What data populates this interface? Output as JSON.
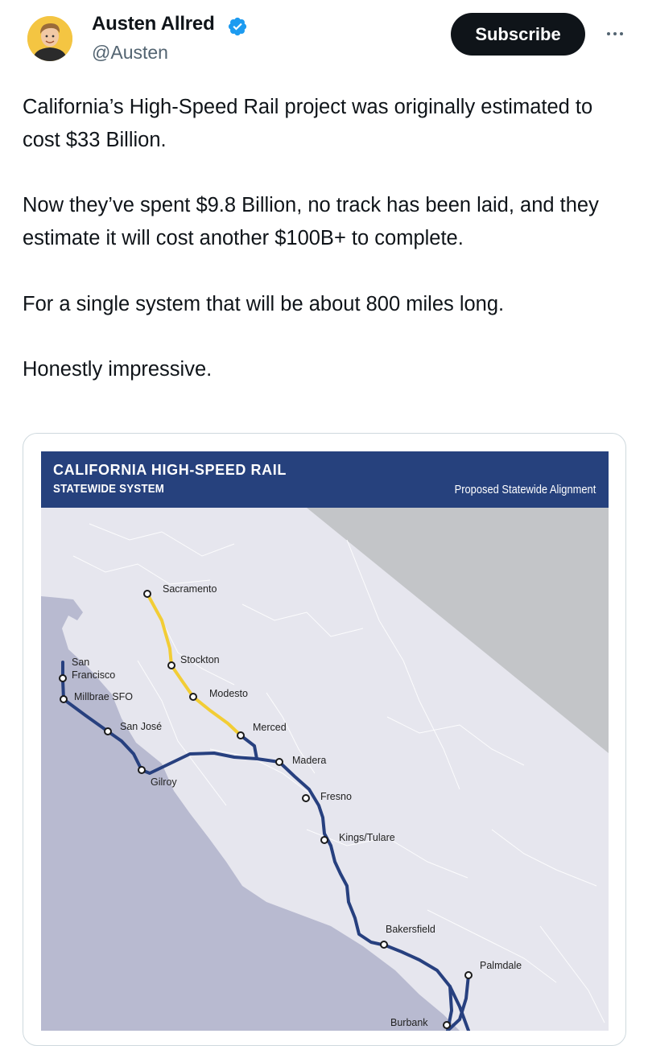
{
  "author": {
    "display_name": "Austen Allred",
    "handle": "@Austen",
    "verified": true,
    "avatar_icon": "avatar-icon"
  },
  "actions": {
    "subscribe_label": "Subscribe",
    "more_icon": "more-horizontal-icon"
  },
  "tweet": {
    "paragraphs": [
      "California’s High-Speed Rail project was originally estimated to cost $33 Billion.",
      "Now they’ve spent $9.8 Billion, no track has been laid, and they estimate it will cost another $100B+ to complete.",
      "For a single system that will be about 800 miles long.",
      "Honestly impressive."
    ]
  },
  "map": {
    "title": "CALIFORNIA HIGH-SPEED RAIL",
    "subtitle": "STATEWIDE SYSTEM",
    "legend_label": "Proposed Statewide Alignment",
    "cities": {
      "sacramento": "Sacramento",
      "stockton": "Stockton",
      "modesto": "Modesto",
      "merced": "Merced",
      "san": "San",
      "francisco": "Francisco",
      "millbrae": "Millbrae SFO",
      "san_jose": "San José",
      "gilroy": "Gilroy",
      "madera": "Madera",
      "fresno": "Fresno",
      "kings_tulare": "Kings/Tulare",
      "bakersfield": "Bakersfield",
      "palmdale": "Palmdale",
      "burbank": "Burbank"
    },
    "colors": {
      "banner": "#26417d",
      "phase1_line": "#27407f",
      "phase2_line": "#f2cd35",
      "ocean": "#b8bad0",
      "land": "#e6e6ee",
      "neighbor_state": "#c3c5c8"
    }
  }
}
